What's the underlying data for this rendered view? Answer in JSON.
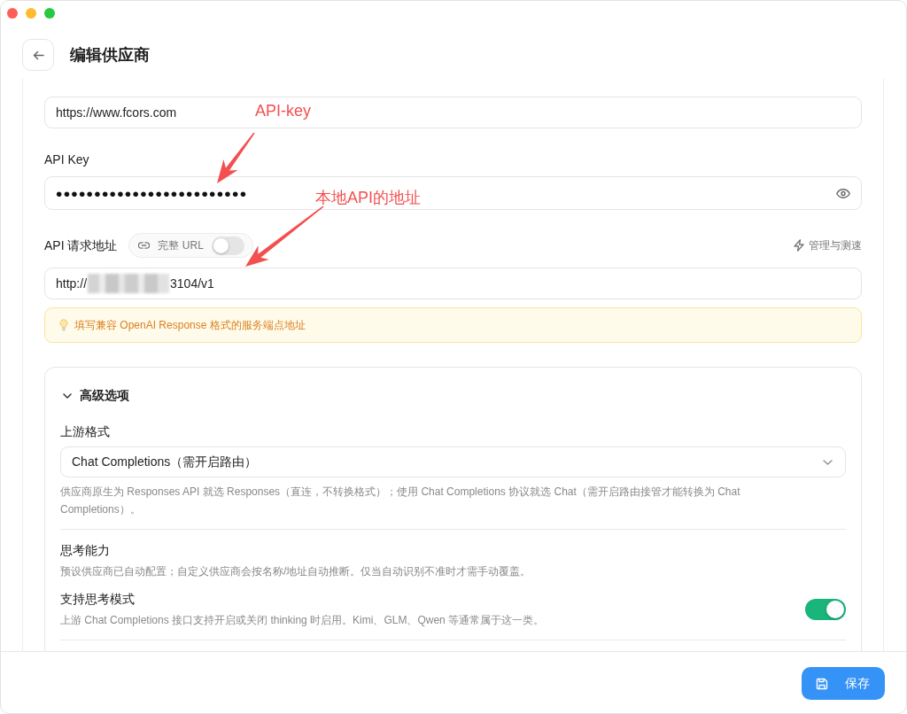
{
  "header": {
    "title": "编辑供应商"
  },
  "form": {
    "website": {
      "value": "https://www.fcors.com"
    },
    "api_key": {
      "label": "API Key",
      "value": "•••••••••••••••••••••••••"
    },
    "endpoint": {
      "label": "API 请求地址",
      "full_url": {
        "label": "完整 URL",
        "on": false
      },
      "action": "管理与测速",
      "value_parts": [
        "http://",
        "3104/v1"
      ],
      "redacted": true,
      "hint": "填写兼容 OpenAI Response 格式的服务端点地址"
    }
  },
  "advanced": {
    "title": "高级选项",
    "expanded": true,
    "upstream_format": {
      "label": "上游格式",
      "value": "Chat Completions（需开启路由）",
      "help": "供应商原生为 Responses API 就选 Responses（直连，不转换格式）；使用 Chat Completions 协议就选 Chat（需开启路由接管才能转换为 Chat Completions）。"
    },
    "thinking": {
      "title": "思考能力",
      "description": "预设供应商已自动配置；自定义供应商会按名称/地址自动推断。仅当自动识别不准时才需手动覆盖。"
    },
    "settings": [
      {
        "label": "支持思考模式",
        "description": "上游 Chat Completions 接口支持开启或关闭 thinking 时启用。Kimi、GLM、Qwen 等通常属于这一类。",
        "on": true
      }
    ]
  },
  "footer": {
    "save_button": "保存"
  },
  "annotations": [
    {
      "text": "API-key"
    },
    {
      "text": "本地API的地址"
    }
  ]
}
